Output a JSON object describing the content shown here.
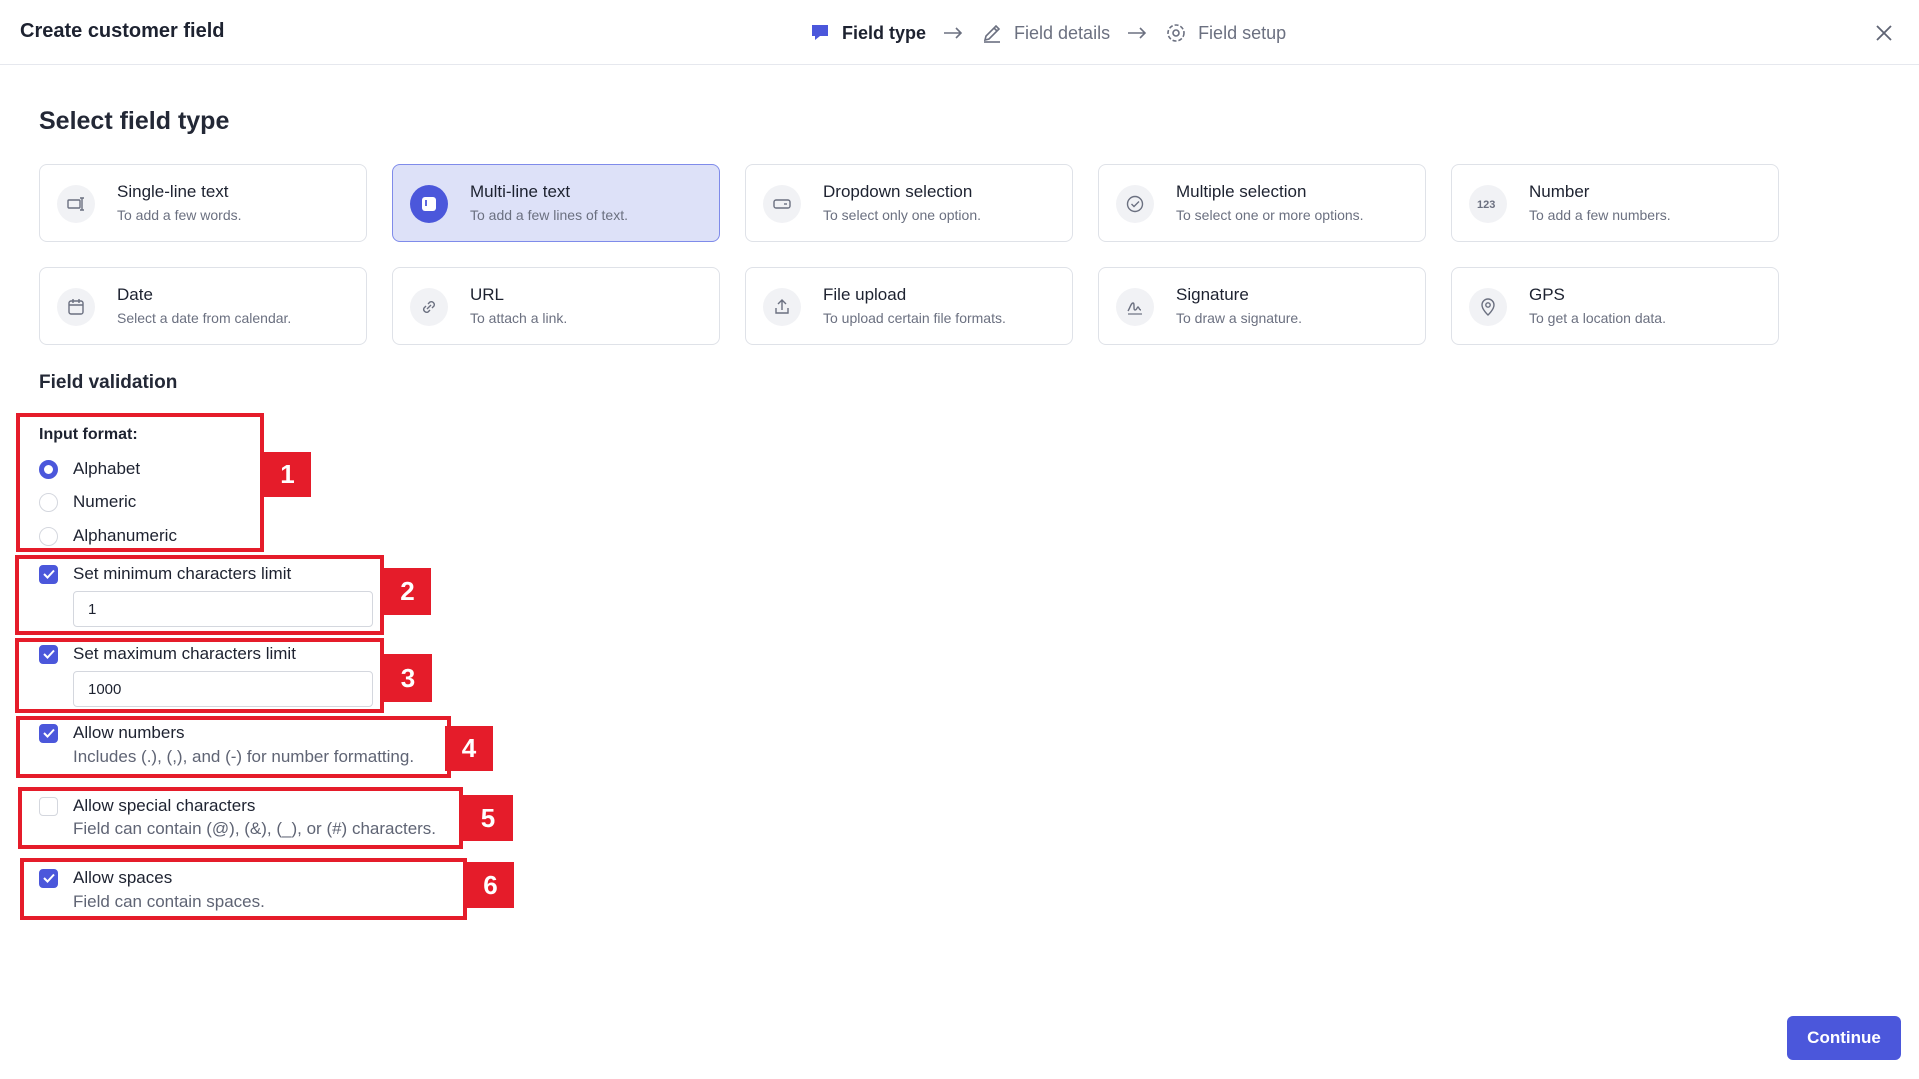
{
  "header": {
    "title": "Create customer field",
    "steps": [
      {
        "label": "Field type",
        "active": true
      },
      {
        "label": "Field details",
        "active": false
      },
      {
        "label": "Field setup",
        "active": false
      }
    ]
  },
  "main": {
    "section_title": "Select field type",
    "field_types": [
      {
        "title": "Single-line text",
        "desc": "To add a few words."
      },
      {
        "title": "Multi-line text",
        "desc": "To add a few lines of text.",
        "selected": true
      },
      {
        "title": "Dropdown selection",
        "desc": "To select only one option."
      },
      {
        "title": "Multiple selection",
        "desc": "To select one or more options."
      },
      {
        "title": "Number",
        "desc": "To add a few numbers."
      },
      {
        "title": "Date",
        "desc": "Select a date from calendar."
      },
      {
        "title": "URL",
        "desc": "To attach a link."
      },
      {
        "title": "File upload",
        "desc": "To upload certain file formats."
      },
      {
        "title": "Signature",
        "desc": "To draw a signature."
      },
      {
        "title": "GPS",
        "desc": "To get a location data."
      }
    ],
    "validation": {
      "title": "Field validation",
      "input_format_label": "Input format:",
      "input_formats": [
        "Alphabet",
        "Numeric",
        "Alphanumeric"
      ],
      "selected_format": "Alphabet",
      "min_label": "Set minimum characters limit",
      "min_value": "1",
      "max_label": "Set maximum characters limit",
      "max_value": "1000",
      "allow_numbers_label": "Allow numbers",
      "allow_numbers_hint": "Includes (.), (,), and (-) for number formatting.",
      "allow_special_label": "Allow special characters",
      "allow_special_hint": "Field can contain (@), (&), (_), or (#) characters.",
      "allow_spaces_label": "Allow spaces",
      "allow_spaces_hint": "Field can contain spaces."
    }
  },
  "annotations": [
    "1",
    "2",
    "3",
    "4",
    "5",
    "6"
  ],
  "footer": {
    "continue_label": "Continue"
  },
  "colors": {
    "accent": "#4b57db",
    "selected_card": "#dde1f8",
    "annotation": "#e51c2a"
  }
}
